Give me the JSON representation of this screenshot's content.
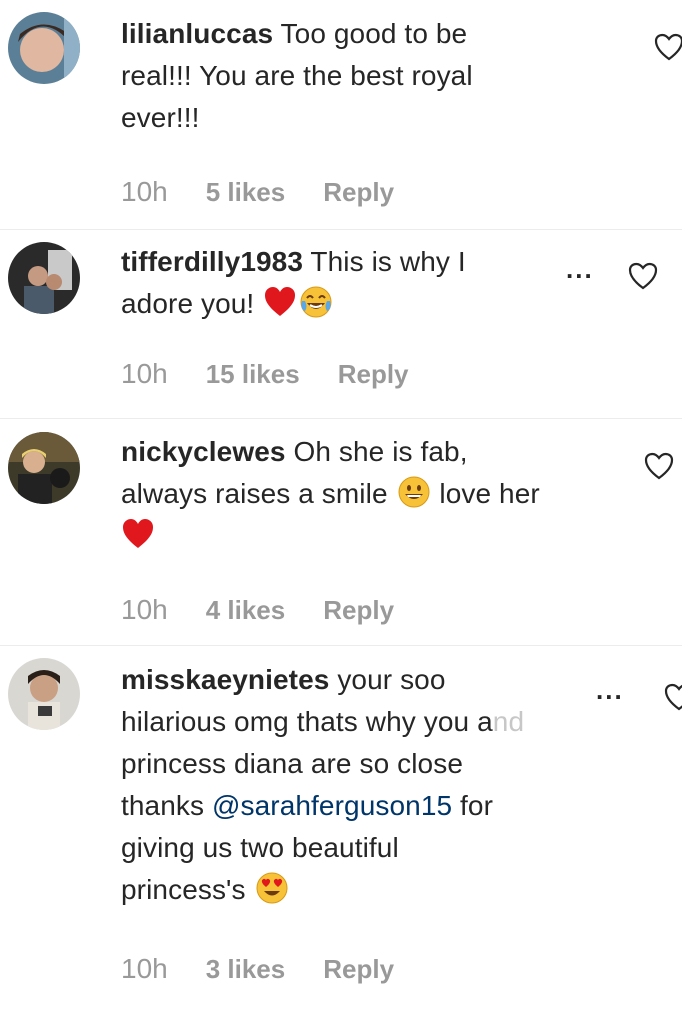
{
  "comments": [
    {
      "username": "lilianluccas",
      "text_lines": [
        " Too good to be",
        "real!!! You are the best royal",
        "ever!!!"
      ],
      "time": "10h",
      "likes": "5 likes",
      "reply": "Reply",
      "show_more": false
    },
    {
      "username": "tifferdilly1983",
      "text_lines": [
        " This is why I",
        "adore you! "
      ],
      "emojis": [
        "red-heart",
        "tears-of-joy"
      ],
      "time": "10h",
      "likes": "15 likes",
      "reply": "Reply",
      "show_more": true,
      "more_label": "..."
    },
    {
      "username": "nickyclewes",
      "text_lines": [
        " Oh she is fab,",
        "always raises a smile ",
        " love her"
      ],
      "emojis": [
        "grinning-face",
        "red-heart"
      ],
      "time": "10h",
      "likes": "4 likes",
      "reply": "Reply",
      "show_more": false
    },
    {
      "username": "misskaeynietes",
      "text_lines": [
        " your soo",
        "hilarious omg thats why you a",
        "nd",
        "princess diana are so close",
        "thanks ",
        "@sarahferguson15",
        " for",
        "giving us two beautiful",
        "princess's "
      ],
      "emojis": [
        "heart-eyes"
      ],
      "time": "10h",
      "likes": "3 likes",
      "reply": "Reply",
      "show_more": true,
      "more_label": "..."
    }
  ],
  "colors": {
    "username": "#262626",
    "meta": "#999999",
    "mention": "#003569",
    "divider": "#ececec"
  }
}
